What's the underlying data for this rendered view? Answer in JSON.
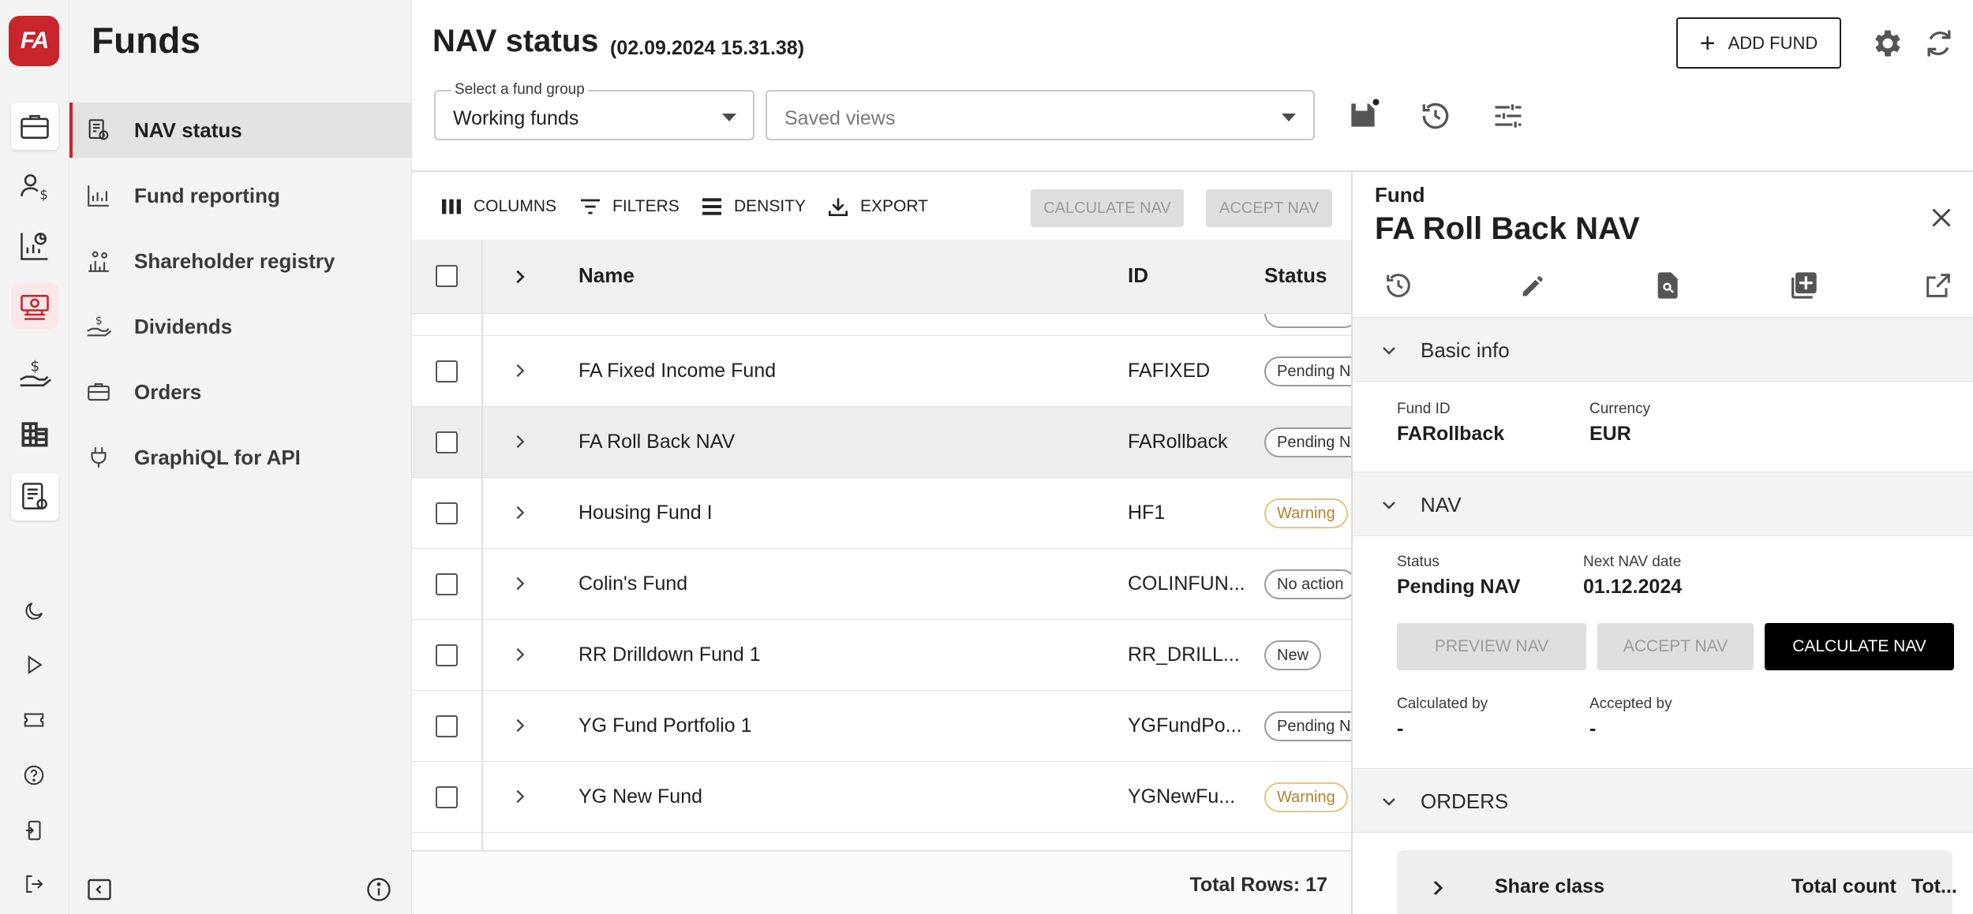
{
  "app": {
    "logo_text": "FA",
    "accent": "#c9252c"
  },
  "sidebar": {
    "title": "Funds",
    "items": [
      {
        "label": "NAV status",
        "icon": "nav-report-icon",
        "active": true
      },
      {
        "label": "Fund reporting",
        "icon": "bar-chart-icon"
      },
      {
        "label": "Shareholder registry",
        "icon": "people-chart-icon"
      },
      {
        "label": "Dividends",
        "icon": "hand-dollar-icon"
      },
      {
        "label": "Orders",
        "icon": "briefcase-icon"
      },
      {
        "label": "GraphiQL for API",
        "icon": "plug-icon"
      }
    ]
  },
  "header": {
    "title": "NAV status",
    "timestamp": "(02.09.2024 15.31.38)",
    "add_fund_label": "ADD FUND",
    "fund_group": {
      "label": "Select a fund group",
      "value": "Working funds"
    },
    "saved_views": {
      "placeholder": "Saved views"
    }
  },
  "toolbar": {
    "columns": "COLUMNS",
    "filters": "FILTERS",
    "density": "DENSITY",
    "export": "EXPORT",
    "calculate_nav": "CALCULATE NAV",
    "accept_nav": "ACCEPT NAV"
  },
  "table": {
    "columns": {
      "name": "Name",
      "id": "ID",
      "status": "Status"
    },
    "rows": [
      {
        "name": "FA Fixed Income Fund",
        "id": "FAFIXED",
        "status": "Pending NAV",
        "tone": "neutral"
      },
      {
        "name": "FA Roll Back NAV",
        "id": "FARollback",
        "status": "Pending NAV",
        "tone": "neutral",
        "selected": true
      },
      {
        "name": "Housing Fund I",
        "id": "HF1",
        "status": "Warning",
        "tone": "warn"
      },
      {
        "name": "Colin's Fund",
        "id": "COLINFUN...",
        "status": "No action",
        "tone": "neutral"
      },
      {
        "name": "RR Drilldown Fund 1",
        "id": "RR_DRILL...",
        "status": "New",
        "tone": "neutral"
      },
      {
        "name": "YG Fund Portfolio 1",
        "id": "YGFundPo...",
        "status": "Pending NAV",
        "tone": "neutral"
      },
      {
        "name": "YG New Fund",
        "id": "YGNewFu...",
        "status": "Warning",
        "tone": "warn"
      }
    ],
    "total_rows": "Total Rows: 17"
  },
  "panel": {
    "kicker": "Fund",
    "title": "FA Roll Back NAV",
    "basic_info": {
      "heading": "Basic info",
      "fund_id_label": "Fund ID",
      "fund_id": "FARollback",
      "currency_label": "Currency",
      "currency": "EUR"
    },
    "nav": {
      "heading": "NAV",
      "status_label": "Status",
      "status": "Pending NAV",
      "next_date_label": "Next NAV date",
      "next_date": "01.12.2024",
      "preview_btn": "PREVIEW NAV",
      "accept_btn": "ACCEPT NAV",
      "calculate_btn": "CALCULATE NAV",
      "calculated_by_label": "Calculated by",
      "calculated_by": "-",
      "accepted_by_label": "Accepted by",
      "accepted_by": "-"
    },
    "orders": {
      "heading": "ORDERS",
      "col_share_class": "Share class",
      "col_total_count": "Total count",
      "col_tot": "Tot..."
    }
  }
}
